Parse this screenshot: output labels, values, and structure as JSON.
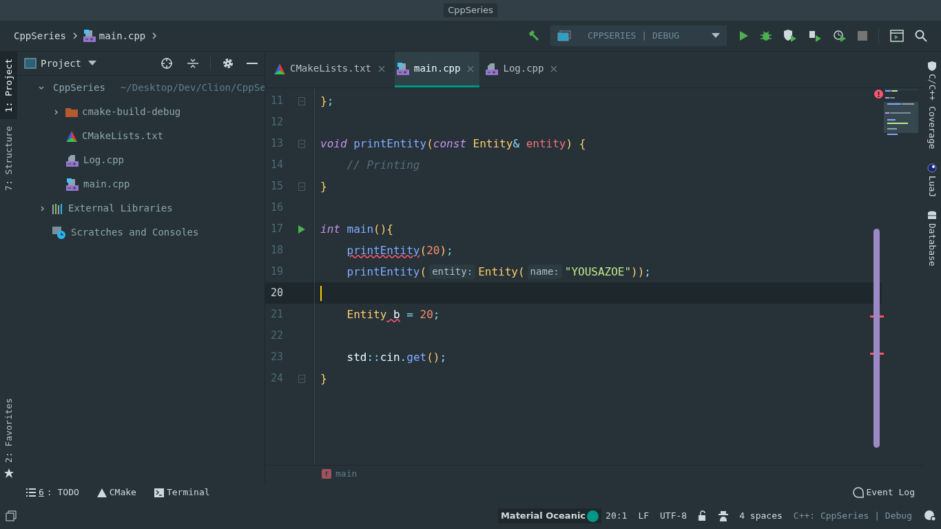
{
  "window": {
    "title": "CppSeries"
  },
  "breadcrumbs": [
    {
      "label": "CppSeries",
      "kind": "project"
    },
    {
      "label": "main.cpp",
      "kind": "cpp-main"
    }
  ],
  "run_config": {
    "label": "CPPSERIES | DEBUG"
  },
  "left_tool_tabs": [
    {
      "label": "1: Project",
      "selected": true
    },
    {
      "label": "7: Structure",
      "selected": false
    }
  ],
  "left_bottom_tabs": [
    {
      "label": "2: Favorites",
      "selected": false
    }
  ],
  "project_panel": {
    "title": "Project",
    "tree": [
      {
        "label": "CppSeries",
        "path": "~/Desktop/Dev/Clion/CppSe",
        "kind": "folder",
        "expanded": true,
        "children": [
          {
            "label": "cmake-build-debug",
            "kind": "folder-build",
            "expanded": false
          },
          {
            "label": "CMakeLists.txt",
            "kind": "cmake"
          },
          {
            "label": "Log.cpp",
            "kind": "cpp"
          },
          {
            "label": "main.cpp",
            "kind": "cpp-main"
          }
        ]
      },
      {
        "label": "External Libraries",
        "kind": "libraries",
        "expanded": false
      },
      {
        "label": "Scratches and Consoles",
        "kind": "scratches"
      }
    ]
  },
  "editor_tabs": [
    {
      "label": "CMakeLists.txt",
      "kind": "cmake",
      "selected": false
    },
    {
      "label": "main.cpp",
      "kind": "cpp-main",
      "selected": true
    },
    {
      "label": "Log.cpp",
      "kind": "cpp",
      "selected": false
    }
  ],
  "code": [
    {
      "number": "11",
      "kind": "fold",
      "indent": false,
      "current": false,
      "tokens": [
        {
          "kind": "punct",
          "text": "}"
        },
        {
          "kind": "op",
          "text": ";"
        }
      ]
    },
    {
      "number": "12",
      "kind": "plain",
      "current": false
    },
    {
      "number": "13",
      "kind": "fold",
      "indent": false,
      "current": false,
      "tokens": [
        {
          "kind": "keyword",
          "text": "void"
        },
        {
          "kind": "function",
          "text": " printEntity"
        },
        {
          "kind": "punct",
          "text": "("
        },
        {
          "kind": "keyword",
          "text": "const"
        },
        {
          "kind": "type",
          "text": " Entity"
        },
        {
          "kind": "op",
          "text": "&"
        },
        {
          "kind": "param",
          "text": " entity"
        },
        {
          "kind": "punct",
          "text": ") {"
        }
      ]
    },
    {
      "number": "14",
      "kind": "plain",
      "indent": true,
      "current": false,
      "tokens": [
        {
          "kind": "comment",
          "text": "// Printing"
        }
      ]
    },
    {
      "number": "15",
      "kind": "fold",
      "indent": false,
      "current": false,
      "tokens": [
        {
          "kind": "punct",
          "text": "}"
        }
      ]
    },
    {
      "number": "16",
      "kind": "plain",
      "current": false
    },
    {
      "number": "17",
      "kind": "run",
      "indent": false,
      "current": false,
      "tokens": [
        {
          "kind": "keyword",
          "text": "int"
        },
        {
          "kind": "function",
          "text": " main"
        },
        {
          "kind": "punct",
          "text": "(){"
        }
      ]
    },
    {
      "number": "18",
      "kind": "plain",
      "indent": true,
      "current": false,
      "tokens": [
        {
          "kind": "function",
          "text": "printEntity",
          "error": true
        },
        {
          "kind": "punct",
          "text": "("
        },
        {
          "kind": "number",
          "text": "20"
        },
        {
          "kind": "punct",
          "text": ")"
        },
        {
          "kind": "op",
          "text": ";"
        }
      ]
    },
    {
      "number": "19",
      "kind": "plain",
      "indent": true,
      "current": false,
      "tokens": [
        {
          "kind": "function",
          "text": "printEntity"
        },
        {
          "kind": "punct",
          "text": "("
        },
        {
          "kind": "hint",
          "text": "entity:"
        },
        {
          "kind": "type",
          "text": "Entity"
        },
        {
          "kind": "punct",
          "text": "("
        },
        {
          "kind": "hint",
          "text": "name:"
        },
        {
          "kind": "string",
          "text": "\"YOUSAZOE\""
        },
        {
          "kind": "punct",
          "text": "))"
        },
        {
          "kind": "op",
          "text": ";"
        }
      ]
    },
    {
      "number": "20",
      "kind": "plain",
      "indent": false,
      "current": true
    },
    {
      "number": "21",
      "kind": "plain",
      "indent": true,
      "current": false,
      "tokens": [
        {
          "kind": "type",
          "text": "Entity"
        },
        {
          "kind": "plain",
          "text": " b",
          "error": true
        },
        {
          "kind": "op",
          "text": " = "
        },
        {
          "kind": "number",
          "text": "20"
        },
        {
          "kind": "op",
          "text": ";"
        }
      ]
    },
    {
      "number": "22",
      "kind": "plain",
      "current": false
    },
    {
      "number": "23",
      "kind": "plain",
      "indent": true,
      "current": false,
      "tokens": [
        {
          "kind": "plain",
          "text": "std"
        },
        {
          "kind": "op",
          "text": "::"
        },
        {
          "kind": "plain",
          "text": "cin"
        },
        {
          "kind": "op",
          "text": "."
        },
        {
          "kind": "function",
          "text": "get"
        },
        {
          "kind": "punct",
          "text": "()"
        },
        {
          "kind": "op",
          "text": ";"
        }
      ]
    },
    {
      "number": "24",
      "kind": "fold",
      "indent": false,
      "current": false,
      "tokens": [
        {
          "kind": "punct",
          "text": "}"
        }
      ]
    }
  ],
  "editor_breadcrumb": {
    "badge": "f",
    "label": "main"
  },
  "right_tool_tabs": [
    {
      "label": "C/C++ Coverage",
      "kind": "shield"
    },
    {
      "label": "LuaJ",
      "kind": "lua"
    },
    {
      "label": "Database",
      "kind": "database"
    }
  ],
  "bottom_tool_tabs": [
    {
      "mnemonic": "6",
      "label": ": TODO",
      "kind": "list"
    },
    {
      "label": "CMake",
      "kind": "cmake"
    },
    {
      "label": "Terminal",
      "kind": "terminal"
    }
  ],
  "event_log": "Event Log",
  "status_bar": {
    "theme": "Material Oceanic",
    "position": "20:1",
    "line_separator": "LF",
    "encoding": "UTF-8",
    "indent": "4 spaces",
    "context": "C++: CppSeries | Debug"
  }
}
